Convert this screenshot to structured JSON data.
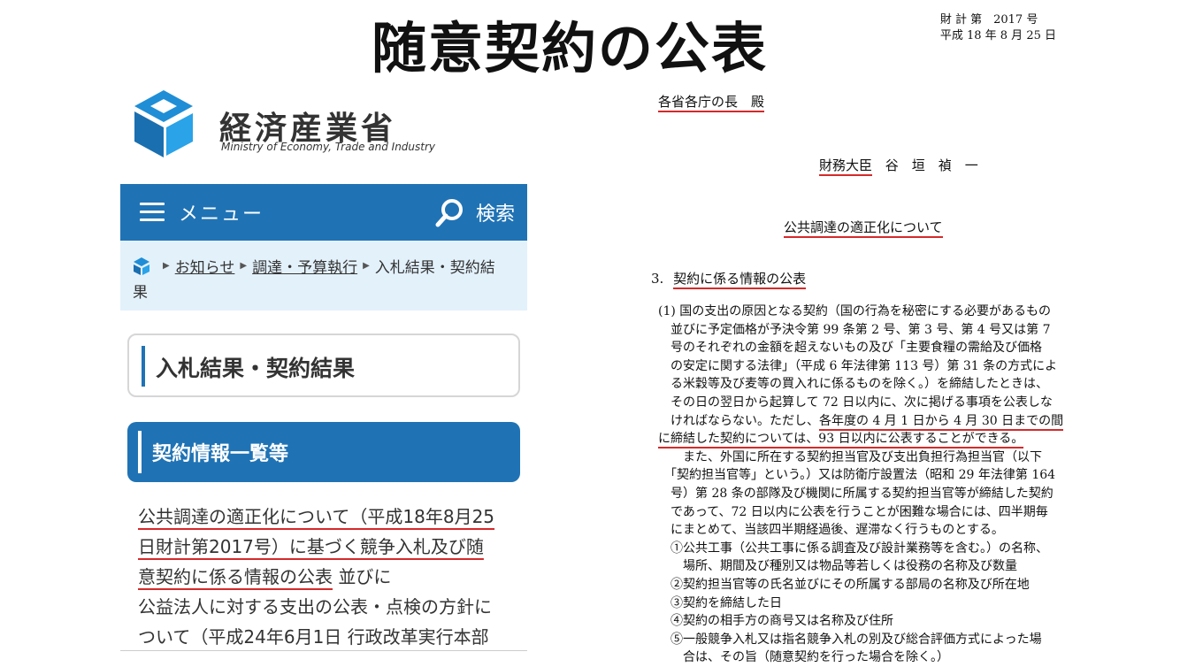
{
  "slide": {
    "title": "随意契約の公表"
  },
  "meti": {
    "logo_ja": "経済産業省",
    "logo_en": "Ministry of Economy, Trade and Industry",
    "nav": {
      "menu_label": "メニュー",
      "search_label": "検索"
    },
    "breadcrumb": {
      "items": [
        "お知らせ",
        "調達・予算執行"
      ],
      "current_line1": "入札結果・契約結",
      "current_line2": "果"
    },
    "page_heading": "入札結果・契約結果",
    "section_heading": "契約情報一覧等",
    "body_lines": [
      "公共調達の適正化について（平成18年8月25",
      "日財計第2017号）に基づく競争入札及び随",
      "意契約に係る情報の公表",
      " 並びに",
      "公益法人に対する支出の公表・点検の方針に",
      "ついて（平成24年6月1日 行政改革実行本部"
    ],
    "colors": {
      "brand_blue": "#1f73b5",
      "breadcrumb_bg": "#e3f1fb",
      "underline_red": "#d42a2a"
    }
  },
  "doc": {
    "number_line1": "財 計 第　2017 号",
    "number_line2": "平成 18 年 8 月 25 日",
    "addressee": "各省各庁の長　殿",
    "sender_title": "財務大臣",
    "sender_name": "谷　垣　禎　一",
    "subject": "公共調達の適正化について",
    "section_num": "3.",
    "section_title": "契約に係る情報の公表",
    "paragraph": [
      "(1) 国の支出の原因となる契約（国の行為を秘密にする必要があるもの",
      "　並びに予定価格が予決令第 99 条第 2 号、第 3 号、第 4 号又は第 7",
      "　号のそれぞれの金額を超えないもの及び「主要食糧の需給及び価格",
      "　の安定に関する法律」（平成 6 年法律第 113 号）第 31 条の方式によ",
      "　る米穀等及び麦等の買入れに係るものを除く。）を締結したときは、",
      "　その日の翌日から起算して 72 日以内に、次に掲げる事項を公表しな",
      "　ければならない。ただし、",
      "各年度の 4 月 1 日から 4 月 30 日までの間",
      "に締結した契約については、93 日以内に公表することができる。",
      "　　また、外国に所在する契約担当官及び支出負担行為担当官（以下",
      "　「契約担当官等」という。）又は防衛庁設置法（昭和 29 年法律第 164",
      "　号）第 28 条の部隊及び機関に所属する契約担当官等が締結した契約",
      "　であって、72 日以内に公表を行うことが困難な場合には、四半期毎",
      "　にまとめて、当該四半期経過後、遅滞なく行うものとする。",
      "　①公共工事（公共工事に係る調査及び設計業務等を含む。）の名称、",
      "　　場所、期間及び種別又は物品等若しくは役務の名称及び数量",
      "　②契約担当官等の氏名並びにその所属する部局の名称及び所在地",
      "　③契約を締結した日",
      "　④契約の相手方の商号又は名称及び住所",
      "　⑤一般競争入札又は指名競争入札の別及び総合評価方式によった場",
      "　　合は、その旨（随意契約を行った場合を除く。）"
    ]
  }
}
